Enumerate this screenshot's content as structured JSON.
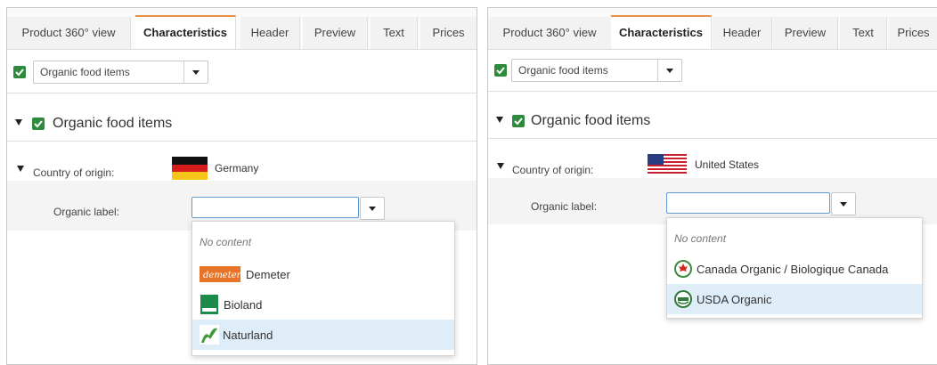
{
  "left": {
    "tabs": [
      "Product 360° view",
      "Characteristics",
      "Header",
      "Preview",
      "Text",
      "Prices"
    ],
    "active_tab": "Characteristics",
    "category_select": "Organic food items",
    "section_title": "Organic food items",
    "country_label": "Country of origin:",
    "country_value": "Germany",
    "organic_label": "Organic label:",
    "dropdown": {
      "empty": "No content",
      "items": [
        "Demeter",
        "Bioland",
        "Naturland"
      ],
      "highlighted": "Naturland"
    },
    "logo_texts": {
      "demeter": "demeter"
    }
  },
  "right": {
    "tabs": [
      "Product 360° view",
      "Characteristics",
      "Header",
      "Preview",
      "Text",
      "Prices"
    ],
    "active_tab": "Characteristics",
    "category_select": "Organic food items",
    "section_title": "Organic food items",
    "country_label": "Country of origin:",
    "country_value": "United States",
    "organic_label": "Organic label:",
    "dropdown": {
      "empty": "No content",
      "items": [
        "Canada Organic / Biologique Canada",
        "USDA Organic"
      ],
      "highlighted": "USDA Organic"
    }
  },
  "colors": {
    "checkbox": "#2e8b3d",
    "active_tab_accent": "#e8924a",
    "highlight": "#dfedf8",
    "input_focus": "#5d9bd5"
  },
  "icons": {
    "checkbox": "check-icon",
    "dropdown": "caret-down-icon",
    "expand": "triangle-down-icon",
    "flag_left": "germany-flag-icon",
    "flag_right": "usa-flag-icon"
  }
}
